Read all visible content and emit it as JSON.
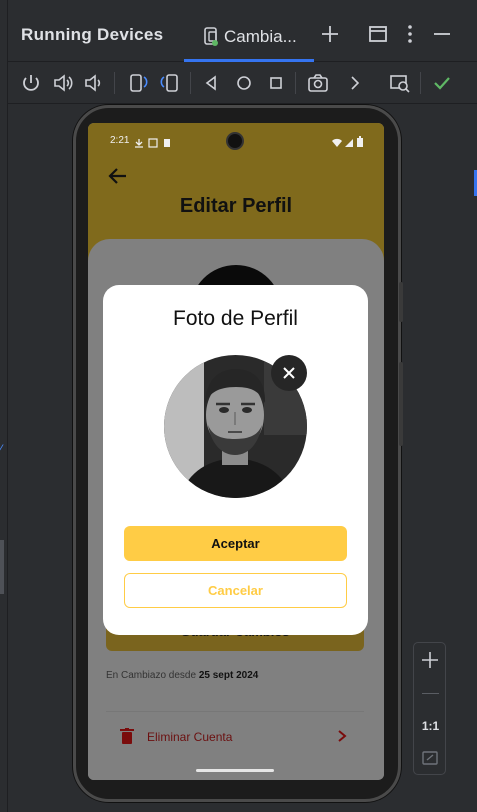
{
  "window": {
    "title": "Running Devices",
    "tab_label": "Cambia..."
  },
  "toolbar": {
    "icons": [
      "power-icon",
      "volume-up-icon",
      "volume-down-icon",
      "rotate-left-icon",
      "rotate-right-icon",
      "back-icon",
      "home-icon",
      "overview-icon",
      "screenshot-icon",
      "more-icon",
      "device-mirror-icon",
      "check-icon"
    ]
  },
  "phone": {
    "status_time": "2:21",
    "page_title": "Editar Perfil",
    "save_button": "Guardar Cambios",
    "member_prefix": "En Cambiazo desde",
    "member_date": "25 sept 2024",
    "delete_account": "Eliminar Cuenta"
  },
  "dialog": {
    "title": "Foto de Perfil",
    "accept": "Aceptar",
    "cancel": "Cancelar"
  },
  "zoom": {
    "one_to_one": "1:1"
  },
  "colors": {
    "accent": "#ffcc45",
    "ide_bg": "#2b2d30",
    "tab_underline": "#3574f0",
    "check": "#5fb865",
    "danger": "#6b1010"
  }
}
